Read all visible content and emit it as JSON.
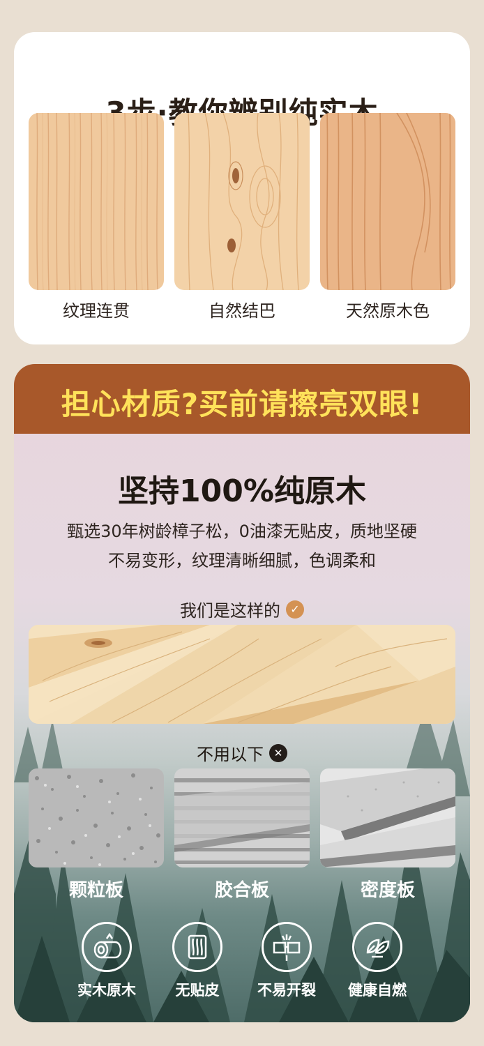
{
  "section1": {
    "title": "3步·教你辨别纯实木",
    "items": [
      {
        "label": "纹理连贯"
      },
      {
        "label": "自然结巴"
      },
      {
        "label": "天然原木色"
      }
    ]
  },
  "section2": {
    "banner": "担心材质?买前请擦亮双眼!",
    "headline": "坚持100%纯原木",
    "desc_line1": "甄选30年树龄樟子松，0油漆无贴皮，质地坚硬",
    "desc_line2": "不易变形，纹理清晰细腻，色调柔和",
    "good_label": "我们是这样的",
    "bad_label": "不用以下",
    "boards": [
      {
        "label": "颗粒板"
      },
      {
        "label": "胶合板"
      },
      {
        "label": "密度板"
      }
    ],
    "features": [
      {
        "label": "实木原木",
        "icon": "log-icon"
      },
      {
        "label": "无贴皮",
        "icon": "wood-grain-icon"
      },
      {
        "label": "不易开裂",
        "icon": "no-crack-icon"
      },
      {
        "label": "健康自燃",
        "icon": "leaf-icon"
      }
    ]
  },
  "colors": {
    "banner_bg": "#a8582a",
    "banner_text": "#ffe25a",
    "check_badge": "#d49253",
    "x_badge": "#231d19"
  }
}
